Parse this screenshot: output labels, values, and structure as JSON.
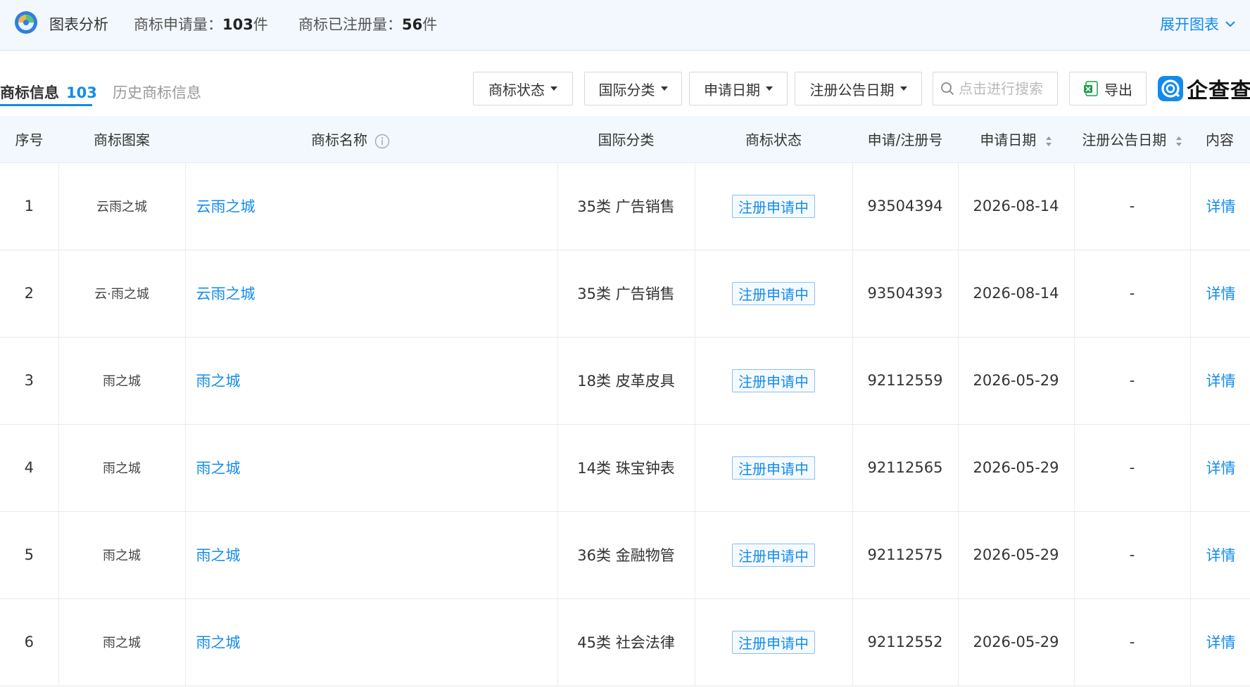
{
  "summary": {
    "title": "图表分析",
    "applied_label": "商标申请量：",
    "applied_count": "103",
    "applied_unit": "件",
    "registered_label": "商标已注册量：",
    "registered_count": "56",
    "registered_unit": "件",
    "expand_label": "展开图表"
  },
  "tabs": {
    "active_label": "商标信息",
    "active_count": "103",
    "history_label": "历史商标信息"
  },
  "filters": {
    "status": "商标状态",
    "intl_class": "国际分类",
    "apply_date": "申请日期",
    "pub_date": "注册公告日期"
  },
  "search": {
    "placeholder": "点击进行搜索"
  },
  "export": {
    "label": "导出"
  },
  "brand": {
    "name": "企查查"
  },
  "table": {
    "headers": {
      "no": "序号",
      "pattern": "商标图案",
      "name": "商标名称",
      "intl_class": "国际分类",
      "status": "商标状态",
      "reg_no": "申请/注册号",
      "apply_date": "申请日期",
      "pub_date": "注册公告日期",
      "content": "内容"
    },
    "rows": [
      {
        "no": "1",
        "pattern": "云雨之城",
        "name": "云雨之城",
        "intl_class": "35类 广告销售",
        "status": "注册申请中",
        "reg_no": "93504394",
        "apply_date": "2026-08-14",
        "pub_date": "-",
        "content": "详情"
      },
      {
        "no": "2",
        "pattern": "云·雨之城",
        "name": "云雨之城",
        "intl_class": "35类 广告销售",
        "status": "注册申请中",
        "reg_no": "93504393",
        "apply_date": "2026-08-14",
        "pub_date": "-",
        "content": "详情"
      },
      {
        "no": "3",
        "pattern": "雨之城",
        "name": "雨之城",
        "intl_class": "18类 皮革皮具",
        "status": "注册申请中",
        "reg_no": "92112559",
        "apply_date": "2026-05-29",
        "pub_date": "-",
        "content": "详情"
      },
      {
        "no": "4",
        "pattern": "雨之城",
        "name": "雨之城",
        "intl_class": "14类 珠宝钟表",
        "status": "注册申请中",
        "reg_no": "92112565",
        "apply_date": "2026-05-29",
        "pub_date": "-",
        "content": "详情"
      },
      {
        "no": "5",
        "pattern": "雨之城",
        "name": "雨之城",
        "intl_class": "36类 金融物管",
        "status": "注册申请中",
        "reg_no": "92112575",
        "apply_date": "2026-05-29",
        "pub_date": "-",
        "content": "详情"
      },
      {
        "no": "6",
        "pattern": "雨之城",
        "name": "雨之城",
        "intl_class": "45类 社会法律",
        "status": "注册申请中",
        "reg_no": "92112552",
        "apply_date": "2026-05-29",
        "pub_date": "-",
        "content": "详情"
      }
    ]
  },
  "icons": {
    "logo": "chart-analysis-logo-icon",
    "expand": "chevron-down-icon",
    "search": "search-icon",
    "export": "excel-icon",
    "brand": "qichacha-logo-icon",
    "info": "info-icon",
    "sort": "sort-icon"
  },
  "colors": {
    "accent": "#128bed",
    "summary_bg": "#f3f8fe",
    "header_bg": "#f2f8fe",
    "excel_green": "#1f9e4a"
  }
}
